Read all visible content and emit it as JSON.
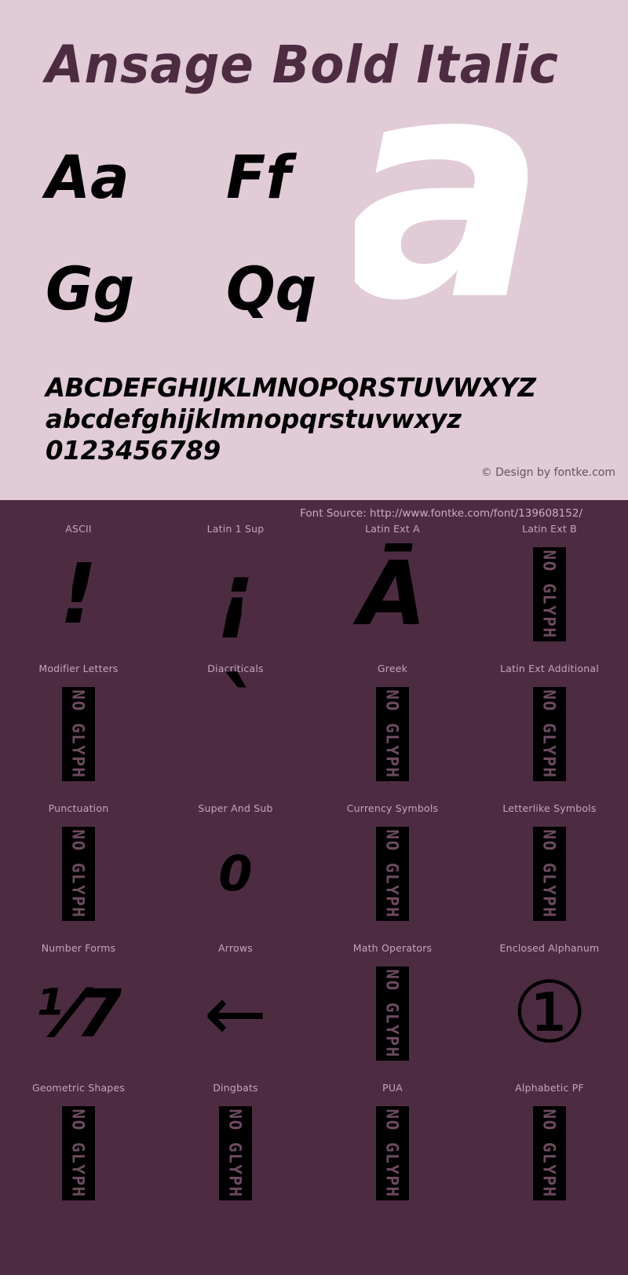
{
  "specimen": {
    "title": "Ansage Bold Italic",
    "hero_glyph": "a",
    "pairs": [
      "Aa",
      "Ff",
      "Gg",
      "Qq"
    ],
    "alphabet_upper": "ABCDEFGHIJKLMNOPQRSTUVWXYZ",
    "alphabet_lower": "abcdefghijklmnopqrstuvwxyz",
    "digits": "0123456789",
    "credit": "© Design by fontke.com",
    "font_source": "Font Source: http://www.fontke.com/font/139608152/"
  },
  "colors": {
    "top_background": "#e0cbd6",
    "bottom_background": "#4d2c42",
    "title_text": "#4d2c42",
    "glyph_black": "#000000",
    "hero_white": "#ffffff",
    "label_text": "#c4a7bb",
    "credit_text": "#5f5560",
    "source_text": "#c9aec0",
    "no_glyph_box": "#000000",
    "no_glyph_text": "#6d4a60"
  },
  "no_glyph_label": "NO GLYPH",
  "coverage": [
    {
      "label": "ASCII",
      "sample": "!",
      "has_glyph": true,
      "glyph_class": "glyph-bang"
    },
    {
      "label": "Latin 1 Sup",
      "sample": "¡",
      "has_glyph": true,
      "glyph_class": "glyph-ibang"
    },
    {
      "label": "Latin Ext A",
      "sample": "Ā",
      "has_glyph": true,
      "glyph_class": "glyph-amacron"
    },
    {
      "label": "Latin Ext B",
      "sample": "",
      "has_glyph": false,
      "glyph_class": ""
    },
    {
      "label": "Modifier Letters",
      "sample": "",
      "has_glyph": false,
      "glyph_class": ""
    },
    {
      "label": "Diacriticals",
      "sample": "`",
      "has_glyph": true,
      "glyph_class": "glyph-grave"
    },
    {
      "label": "Greek",
      "sample": "",
      "has_glyph": false,
      "glyph_class": ""
    },
    {
      "label": "Latin Ext Additional",
      "sample": "",
      "has_glyph": false,
      "glyph_class": ""
    },
    {
      "label": "Punctuation",
      "sample": "",
      "has_glyph": false,
      "glyph_class": ""
    },
    {
      "label": "Super And Sub",
      "sample": "0",
      "has_glyph": true,
      "glyph_class": "glyph-zero"
    },
    {
      "label": "Currency Symbols",
      "sample": "",
      "has_glyph": false,
      "glyph_class": ""
    },
    {
      "label": "Letterlike Symbols",
      "sample": "",
      "has_glyph": false,
      "glyph_class": ""
    },
    {
      "label": "Number Forms",
      "sample": "⅟7",
      "has_glyph": true,
      "glyph_class": "glyph-fraction"
    },
    {
      "label": "Arrows",
      "sample": "←",
      "has_glyph": true,
      "glyph_class": "glyph-arrow"
    },
    {
      "label": "Math Operators",
      "sample": "",
      "has_glyph": false,
      "glyph_class": ""
    },
    {
      "label": "Enclosed Alphanum",
      "sample": "①",
      "has_glyph": true,
      "glyph_class": "glyph-circled"
    },
    {
      "label": "Geometric Shapes",
      "sample": "",
      "has_glyph": false,
      "glyph_class": ""
    },
    {
      "label": "Dingbats",
      "sample": "",
      "has_glyph": false,
      "glyph_class": ""
    },
    {
      "label": "PUA",
      "sample": "",
      "has_glyph": false,
      "glyph_class": ""
    },
    {
      "label": "Alphabetic PF",
      "sample": "",
      "has_glyph": false,
      "glyph_class": ""
    }
  ]
}
